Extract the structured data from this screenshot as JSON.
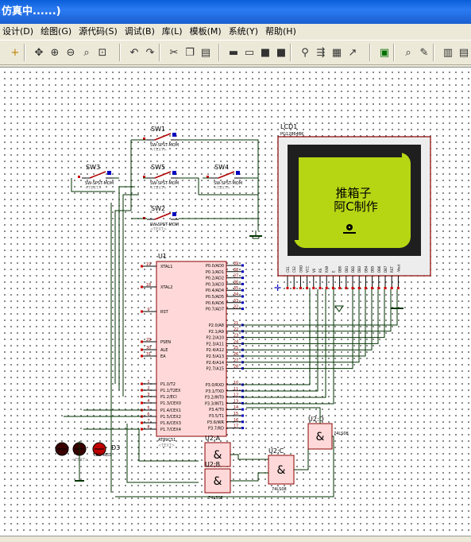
{
  "window": {
    "title": "仿真中......)"
  },
  "menu": [
    "设计(D)",
    "绘图(G)",
    "源代码(S)",
    "调试(B)",
    "库(L)",
    "模板(M)",
    "系统(Y)",
    "帮助(H)"
  ],
  "toolbar": {
    "icons": [
      "plus-icon",
      "move-icon",
      "zoom-in-icon",
      "zoom-out-icon",
      "zoom-all-icon",
      "zoom-area-icon",
      "undo-icon",
      "redo-icon",
      "cut-icon",
      "copy-icon",
      "paste-icon",
      "block-copy-icon",
      "block-move-icon",
      "block-rotate-icon",
      "block-delete-icon",
      "pick-device-icon",
      "make-device-icon",
      "package-icon",
      "decompose-icon",
      "wire-autorouter-icon",
      "search-icon",
      "property-tool-icon",
      "netlist-icon",
      "bom-icon"
    ]
  },
  "schematic": {
    "switches": [
      {
        "name": "SW1",
        "part": "SW-SPST-MOM"
      },
      {
        "name": "SW3",
        "part": "SW-SPST-MOM"
      },
      {
        "name": "SW5",
        "part": "SW-SPST-MOM"
      },
      {
        "name": "SW4",
        "part": "SW-SPST-MOM"
      },
      {
        "name": "SW2",
        "part": "SW-SPST-MOM"
      }
    ],
    "text_placeholder": "<TEXT>",
    "lcd": {
      "name": "LCD1",
      "part": "PG12864BK",
      "screen_line1": "推箱子",
      "screen_line2": "阿C制作",
      "pins": [
        "CS1",
        "CS2",
        "GND",
        "VCC",
        "V0",
        "RS",
        "R/W",
        "E",
        "DB0",
        "DB1",
        "DB2",
        "DB3",
        "DB4",
        "DB5",
        "DB6",
        "DB7",
        "RST",
        "-Vout"
      ]
    },
    "mcu": {
      "name": "U1",
      "part": "AT89C51",
      "left_pins": [
        {
          "num": "19",
          "name": "XTAL1"
        },
        {
          "num": "18",
          "name": "XTAL2"
        },
        {
          "num": "9",
          "name": "RST"
        },
        {
          "num": "29",
          "name": "PSEN"
        },
        {
          "num": "30",
          "name": "ALE"
        },
        {
          "num": "31",
          "name": "EA"
        },
        {
          "num": "1",
          "name": "P1.0/T2"
        },
        {
          "num": "2",
          "name": "P1.1/T2EX"
        },
        {
          "num": "3",
          "name": "P1.2/ECI"
        },
        {
          "num": "4",
          "name": "P1.3/CEX0"
        },
        {
          "num": "5",
          "name": "P1.4/CEX1"
        },
        {
          "num": "6",
          "name": "P1.5/CEX2"
        },
        {
          "num": "7",
          "name": "P1.6/CEX3"
        },
        {
          "num": "8",
          "name": "P1.7/CEX4"
        }
      ],
      "right_pins": [
        {
          "num": "39",
          "name": "P0.0/AD0"
        },
        {
          "num": "38",
          "name": "P0.1/AD1"
        },
        {
          "num": "37",
          "name": "P0.2/AD2"
        },
        {
          "num": "36",
          "name": "P0.3/AD3"
        },
        {
          "num": "35",
          "name": "P0.4/AD4"
        },
        {
          "num": "34",
          "name": "P0.5/AD5"
        },
        {
          "num": "33",
          "name": "P0.6/AD6"
        },
        {
          "num": "32",
          "name": "P0.7/AD7"
        },
        {
          "num": "21",
          "name": "P2.0/A8"
        },
        {
          "num": "22",
          "name": "P2.1/A9"
        },
        {
          "num": "23",
          "name": "P2.2/A10"
        },
        {
          "num": "24",
          "name": "P2.3/A11"
        },
        {
          "num": "25",
          "name": "P2.4/A12"
        },
        {
          "num": "26",
          "name": "P2.5/A13"
        },
        {
          "num": "27",
          "name": "P2.6/A14"
        },
        {
          "num": "28",
          "name": "P2.7/A15"
        },
        {
          "num": "10",
          "name": "P3.0/RXD"
        },
        {
          "num": "11",
          "name": "P3.1/TXD"
        },
        {
          "num": "12",
          "name": "P3.2/INT0"
        },
        {
          "num": "13",
          "name": "P3.3/INT1"
        },
        {
          "num": "14",
          "name": "P3.4/T0"
        },
        {
          "num": "15",
          "name": "P3.5/T1"
        },
        {
          "num": "16",
          "name": "P3.6/WR"
        },
        {
          "num": "17",
          "name": "P3.7/RD"
        }
      ]
    },
    "gates": [
      {
        "name": "U2:A",
        "part": "74LS08",
        "symbol": "&",
        "pins": [
          "1",
          "2",
          "3"
        ]
      },
      {
        "name": "U2:B",
        "part": "74LS08",
        "symbol": "&",
        "pins": [
          "4",
          "5",
          "6"
        ]
      },
      {
        "name": "U2:C",
        "part": "74LS08",
        "symbol": "&",
        "pins": [
          "9",
          "10",
          "8"
        ]
      },
      {
        "name": "U2:D",
        "part": "74LS08",
        "symbol": "&",
        "pins": [
          "12",
          "13",
          "11"
        ]
      }
    ],
    "leds": {
      "name": "D3",
      "part": "LED-RED"
    }
  },
  "colors": {
    "component_body": "#ffd9d9",
    "component_border": "#8b0000",
    "wire": "#003300",
    "lcd_frame": "#2b2b2b",
    "lcd_screen": "#b6d614",
    "pin_number_color": "#8b0000"
  }
}
